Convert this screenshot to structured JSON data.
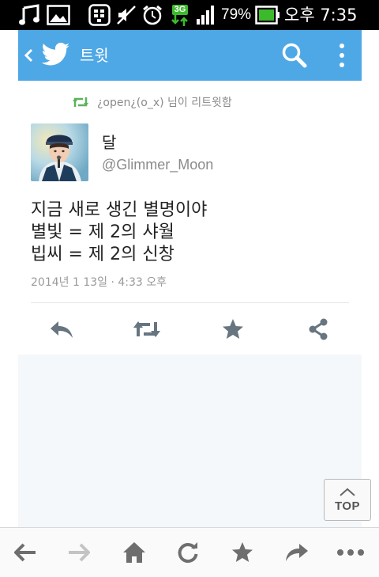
{
  "statusbar": {
    "battery_percent": "79%",
    "time": "오후 7:35",
    "network_label": "3G",
    "icons": [
      "music-icon",
      "image-icon",
      "bbm-icon",
      "mute-icon",
      "alarm-icon",
      "3g-data-icon",
      "signal-icon",
      "battery-icon"
    ]
  },
  "appbar": {
    "back_icon": "chevron-left-icon",
    "logo_icon": "twitter-bird-icon",
    "title": "트윗",
    "search_icon": "search-icon",
    "menu_icon": "overflow-menu-icon",
    "color": "#4fa8e6"
  },
  "tweet": {
    "retweeted_by": "¿open¿(o_x) 님이 리트윗함",
    "user_name": "달",
    "user_handle": "@Glimmer_Moon",
    "lines": [
      "지금 새로 생긴 별명이야",
      "별빛 = 제 2의 샤월",
      "빕씨 = 제 2의 신창"
    ],
    "timestamp": "2014년 1 13일 · 4:33 오후",
    "retweet_color": "#5bb35b"
  },
  "actions": [
    "reply-icon",
    "retweet-icon",
    "favorite-icon",
    "share-icon"
  ],
  "top_button": {
    "label": "TOP"
  },
  "toolbar": [
    "back-arrow-icon",
    "forward-arrow-icon",
    "home-icon",
    "refresh-icon",
    "bookmark-star-icon",
    "share-arrow-icon",
    "more-dots-icon"
  ]
}
